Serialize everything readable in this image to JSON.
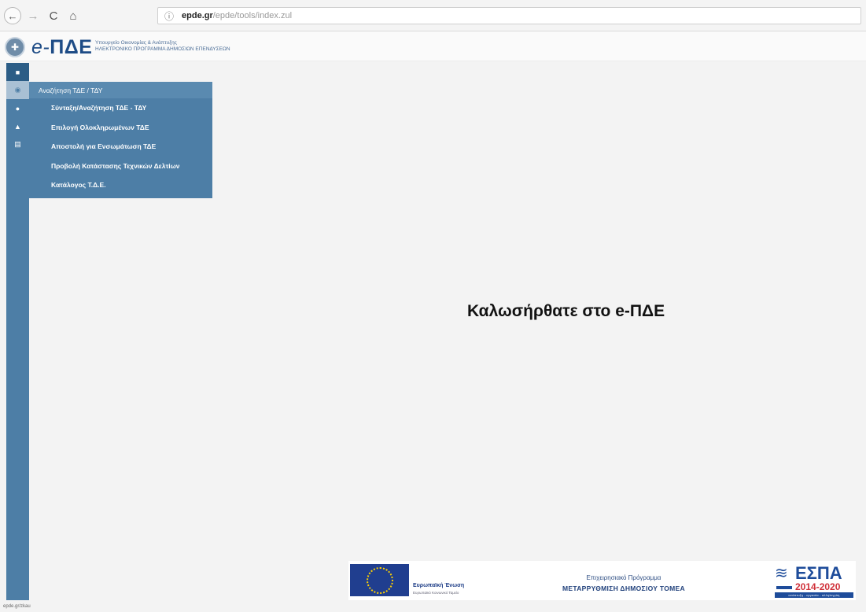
{
  "browser": {
    "back_icon": "←",
    "forward_icon": "→",
    "reload_icon": "C",
    "home_icon": "⌂",
    "info_icon": "ⓘ",
    "url_domain": "epde.gr",
    "url_path": "/epde/tools/index.zul"
  },
  "header": {
    "seal_icon": "✚",
    "logo_e": "e-",
    "logo_text": "ΠΔΕ",
    "ministry_line1": "Υπουργείο Οικονομίας & Ανάπτυξης",
    "ministry_line2": "ΗΛΕΚΤΡΟΝΙΚΟ ΠΡΟΓΡΑΜΜΑ ΔΗΜΟΣΙΩΝ ΕΠΕΝΔΥΣΕΩΝ"
  },
  "rail": {
    "items": [
      {
        "name": "home",
        "glyph": "■"
      },
      {
        "name": "search",
        "glyph": "◉"
      },
      {
        "name": "messages",
        "glyph": "●"
      },
      {
        "name": "users",
        "glyph": "▲"
      },
      {
        "name": "print",
        "glyph": "▤"
      }
    ]
  },
  "menu": {
    "header": "Αναζήτηση ΤΔΕ / ΤΔΥ",
    "items": [
      "Σύνταξη/Αναζήτηση ΤΔΕ - ΤΔΥ",
      "Επιλογή Ολοκληρωμένων ΤΔΕ",
      "Αποστολή για Ενσωμάτωση ΤΔΕ",
      "Προβολή Κατάστασης Τεχνικών Δελτίων",
      "Κατάλογος Τ.Δ.Ε."
    ]
  },
  "main": {
    "welcome": "Καλωσήρθατε στο e-ΠΔΕ"
  },
  "footer": {
    "eu_name": "Ευρωπαϊκή Ένωση",
    "eu_sub": "Ευρωπαϊκό Κοινωνικό Ταμείο",
    "op_title": "Επιχειρησιακό Πρόγραμμα",
    "op_name": "ΜΕΤΑΡΡΥΘΜΙΣΗ ΔΗΜΟΣΙΟΥ ΤΟΜΕΑ",
    "espa_mark": "≋",
    "espa_name": "ΕΣΠΑ",
    "espa_years": "2014-2020",
    "espa_slogan": "ανάπτυξη - εργασία - αλληλεγγύη"
  },
  "status_text": "epde.gr/zkau"
}
